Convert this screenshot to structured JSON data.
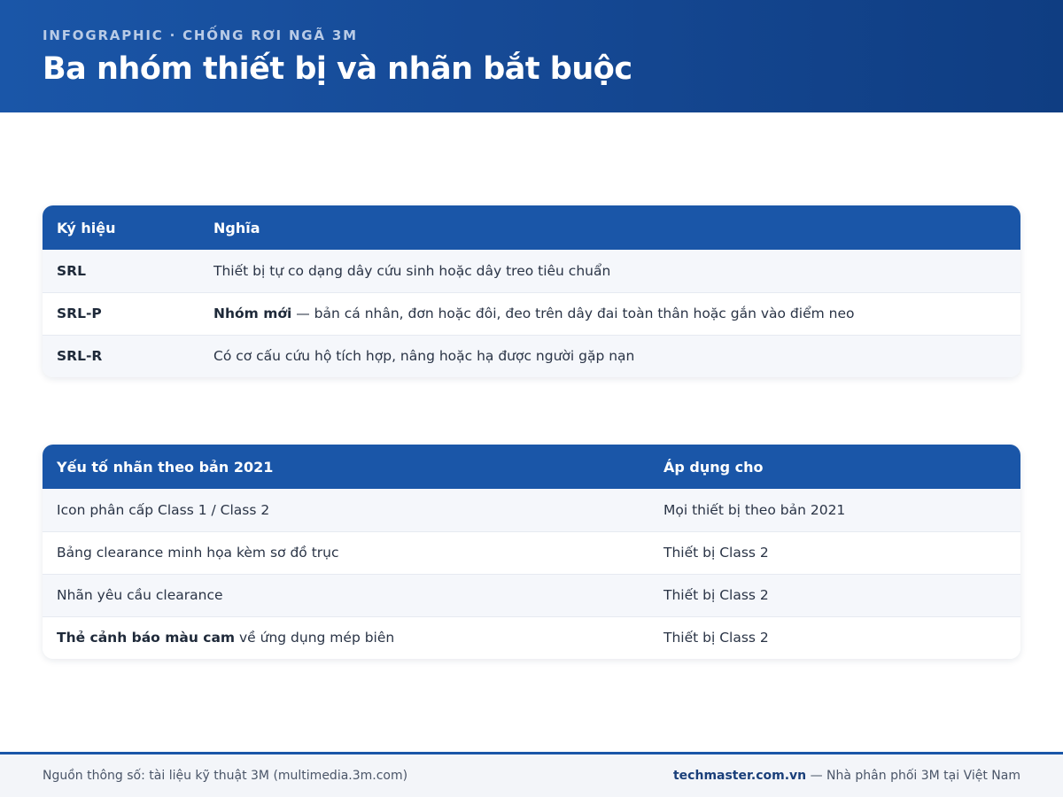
{
  "header": {
    "eyebrow": "INFOGRAPHIC · CHỐNG RƠI NGÃ 3M",
    "title": "Ba nhóm thiết bị và nhãn bắt buộc"
  },
  "symbols_table": {
    "headers": [
      "Ký hiệu",
      "Nghĩa"
    ],
    "rows": [
      {
        "code": "SRL",
        "bold": "",
        "meaning": "Thiết bị tự co dạng dây cứu sinh hoặc dây treo tiêu chuẩn"
      },
      {
        "code": "SRL-P",
        "bold": "Nhóm mới",
        "meaning": " — bản cá nhân, đơn hoặc đôi, đeo trên dây đai toàn thân hoặc gắn vào điểm neo"
      },
      {
        "code": "SRL-R",
        "bold": "",
        "meaning": "Có cơ cấu cứu hộ tích hợp, nâng hoặc hạ được người gặp nạn"
      }
    ]
  },
  "labels_table": {
    "headers": [
      "Yếu tố nhãn theo bản 2021",
      "Áp dụng cho"
    ],
    "rows": [
      {
        "bold": "",
        "element": "Icon phân cấp Class 1 / Class 2",
        "applies": "Mọi thiết bị theo bản 2021"
      },
      {
        "bold": "",
        "element": "Bảng clearance minh họa kèm sơ đồ trục",
        "applies": "Thiết bị Class 2"
      },
      {
        "bold": "",
        "element": "Nhãn yêu cầu clearance",
        "applies": "Thiết bị Class 2"
      },
      {
        "bold": "Thẻ cảnh báo màu cam",
        "element": " về ứng dụng mép biên",
        "applies": "Thiết bị Class 2"
      }
    ]
  },
  "footer": {
    "source": "Nguồn thông số: tài liệu kỹ thuật 3M (multimedia.3m.com)",
    "brand": "techmaster.com.vn",
    "tagline": " — Nhà phân phối 3M tại Việt Nam"
  },
  "colors": {
    "primary": "#1a56a8",
    "header_dark": "#0f3d82",
    "row_alt": "#f5f7fb",
    "footer_bg": "#f3f5f9"
  }
}
